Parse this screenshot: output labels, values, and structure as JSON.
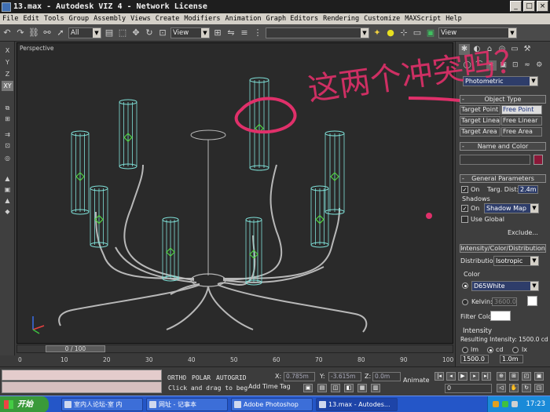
{
  "window": {
    "title": "13.max - Autodesk VIZ 4 - Network License"
  },
  "menu": [
    "File",
    "Edit",
    "Tools",
    "Group",
    "Assembly",
    "Views",
    "Create",
    "Modifiers",
    "Animation",
    "Graph Editors",
    "Rendering",
    "Customize",
    "MAXScript",
    "Help"
  ],
  "toolbar": {
    "selection_filter": "All",
    "ref_coord": "View",
    "named_selection": "",
    "view_dropdown": "View"
  },
  "left_strip": {
    "axis_x": "X",
    "axis_y": "Y",
    "axis_z": "Z",
    "axis_xy": "XY"
  },
  "viewport": {
    "label": "Perspective"
  },
  "annotation": {
    "text": "这两个冲突吗？",
    "color": "#e0306a"
  },
  "time": {
    "slider_label": "0 / 100",
    "ruler_ticks": [
      "0",
      "10",
      "20",
      "30",
      "40",
      "50",
      "60",
      "70",
      "80",
      "90",
      "100"
    ]
  },
  "status": {
    "ortho": "ORTHO",
    "polar": "POLAR",
    "autogrid": "AUTOGRID",
    "x_label": "X:",
    "x_value": "0.785m",
    "y_label": "Y:",
    "y_value": "-3.615m",
    "z_label": "Z:",
    "z_value": "0.0m",
    "prompt": "Click and drag to beg",
    "add_time_tag": "Add Time Tag",
    "animate": "Animate",
    "frame": "0"
  },
  "command_panel": {
    "category": "Photometric",
    "object_type_header": "Object Type",
    "object_types": [
      "Target Point",
      "Free Point",
      "Target Linear",
      "Free Linear",
      "Target Area",
      "Free Area"
    ],
    "name_color_header": "Name and Color",
    "object_name": "",
    "object_color": "#8a1838",
    "general_header": "General Parameters",
    "on_label": "On",
    "targ_dist_label": "Targ. Dist:",
    "targ_dist_value": "2.4m",
    "shadows_label": "Shadows",
    "shadows_on_label": "On",
    "shadow_type": "Shadow Map",
    "use_global_label": "Use Global",
    "exclude_label": "Exclude...",
    "intensity_header": "Intensity/Color/Distribution",
    "distribution_label": "Distribution:",
    "distribution_value": "Isotropic",
    "color_label": "Color",
    "color_preset": "D65White",
    "kelvin_label": "Kelvin:",
    "kelvin_value": "3600.0",
    "filter_color_label": "Filter Color:",
    "intensity_label": "Intensity",
    "resulting_intensity": "Resulting Intensity: 1500.0 cd",
    "unit_lm": "lm",
    "unit_cd": "cd",
    "unit_lx": "lx",
    "intensity_value": "1500.0",
    "distance_value": "1.0m"
  },
  "taskbar": {
    "start": "开始",
    "items": [
      "室内人论坛-室 内",
      "网址 - 记事本",
      "Adobe Photoshop",
      "13.max - Autodes..."
    ],
    "clock": "17:23"
  }
}
